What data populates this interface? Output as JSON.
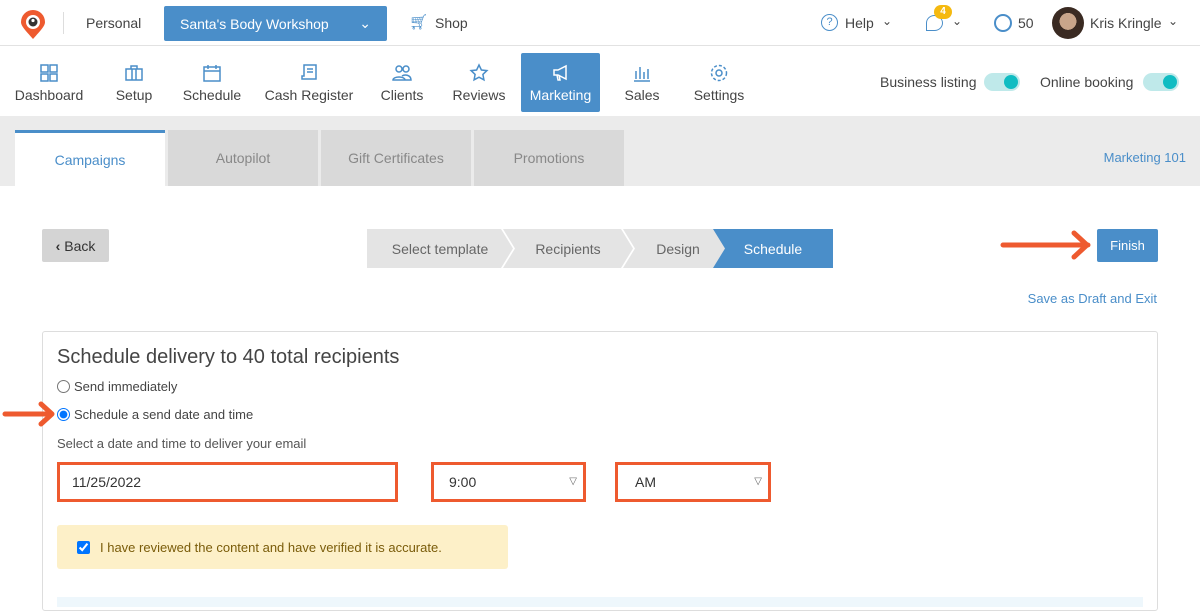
{
  "topbar": {
    "account": "Personal",
    "business": "Santa's Body Workshop",
    "shop": "Shop",
    "help": "Help",
    "notifications_count": "4",
    "points": "50",
    "user": "Kris Kringle"
  },
  "nav": {
    "items": [
      {
        "label": "Dashboard",
        "icon": "grid-icon"
      },
      {
        "label": "Setup",
        "icon": "briefcase-icon"
      },
      {
        "label": "Schedule",
        "icon": "calendar-icon"
      },
      {
        "label": "Cash Register",
        "icon": "receipt-icon"
      },
      {
        "label": "Clients",
        "icon": "users-icon"
      },
      {
        "label": "Reviews",
        "icon": "star-icon"
      },
      {
        "label": "Marketing",
        "icon": "megaphone-icon",
        "active": true
      },
      {
        "label": "Sales",
        "icon": "bar-chart-icon"
      },
      {
        "label": "Settings",
        "icon": "gear-icon"
      }
    ],
    "business_listing": "Business listing",
    "business_listing_on": true,
    "online_booking": "Online booking",
    "online_booking_on": true
  },
  "tabs": [
    {
      "label": "Campaigns",
      "active": true
    },
    {
      "label": "Autopilot"
    },
    {
      "label": "Gift Certificates"
    },
    {
      "label": "Promotions"
    }
  ],
  "marketing_101": "Marketing 101",
  "back": "Back",
  "steps": [
    "Select template",
    "Recipients",
    "Design",
    "Schedule"
  ],
  "active_step": "Schedule",
  "finish": "Finish",
  "save_draft": "Save as Draft and Exit",
  "panel": {
    "title": "Schedule delivery to 40 total recipients",
    "option_immediate": "Send immediately",
    "option_schedule": "Schedule a send date and time",
    "selected": "Schedule a send date and time",
    "prompt": "Select a date and time to deliver your email",
    "date": "11/25/2022",
    "time": "9:00",
    "ampm": "AM",
    "confirm": "I have reviewed the content and have verified it is accurate.",
    "confirm_checked": true
  },
  "colors": {
    "primary": "#4a8ec9",
    "annotation": "#ee5a2f",
    "toggle": "#10bcc2",
    "notice_bg": "#fdf0c8"
  }
}
